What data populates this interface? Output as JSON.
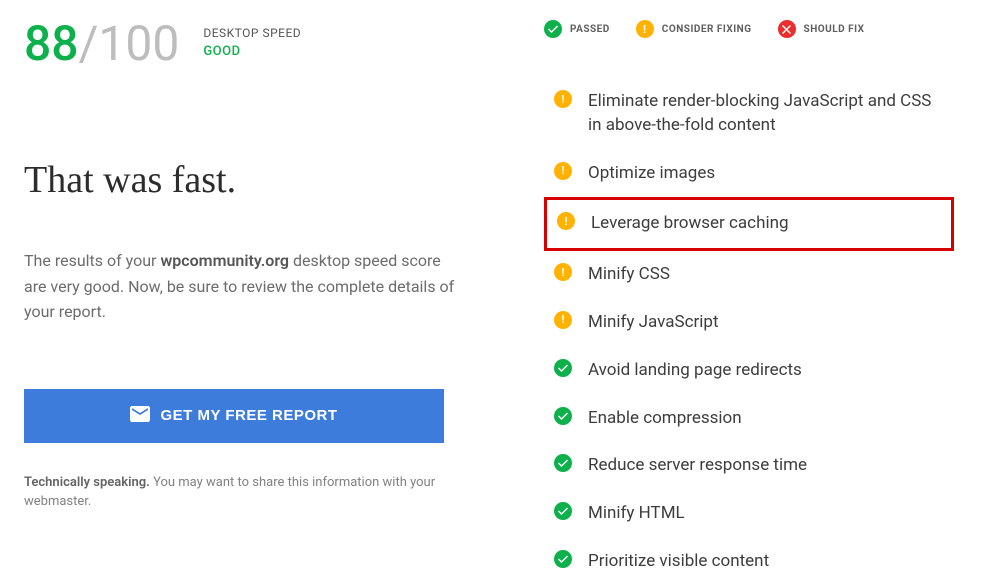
{
  "score": {
    "value": "88",
    "separator": "/",
    "max": "100",
    "label": "DESKTOP SPEED",
    "rating": "GOOD"
  },
  "headline": "That was fast.",
  "summary": {
    "prefix": "The results of your ",
    "domain": "wpcommunity.org",
    "suffix": " desktop speed score are very good. Now, be sure to review the complete details of your report."
  },
  "cta": {
    "label": "GET MY FREE REPORT"
  },
  "footnote": {
    "strong": "Technically speaking.",
    "text": " You may want to share this information with your webmaster."
  },
  "legend": {
    "passed": "PASSED",
    "consider": "CONSIDER FIXING",
    "fix": "SHOULD FIX"
  },
  "issues": [
    {
      "status": "warn",
      "label": "Eliminate render-blocking JavaScript and CSS in above-the-fold content",
      "highlighted": false
    },
    {
      "status": "warn",
      "label": "Optimize images",
      "highlighted": false
    },
    {
      "status": "warn",
      "label": "Leverage browser caching",
      "highlighted": true
    },
    {
      "status": "warn",
      "label": "Minify CSS",
      "highlighted": false
    },
    {
      "status": "warn",
      "label": "Minify JavaScript",
      "highlighted": false
    },
    {
      "status": "pass",
      "label": "Avoid landing page redirects",
      "highlighted": false
    },
    {
      "status": "pass",
      "label": "Enable compression",
      "highlighted": false
    },
    {
      "status": "pass",
      "label": "Reduce server response time",
      "highlighted": false
    },
    {
      "status": "pass",
      "label": "Minify HTML",
      "highlighted": false
    },
    {
      "status": "pass",
      "label": "Prioritize visible content",
      "highlighted": false
    }
  ]
}
